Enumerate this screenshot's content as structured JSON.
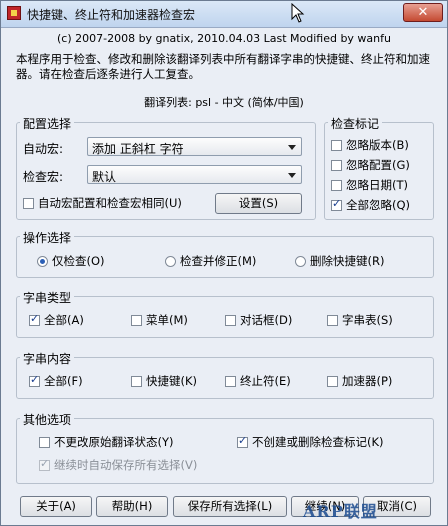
{
  "window": {
    "title": "快捷键、终止符和加速器检查宏",
    "close_label": "✕"
  },
  "header": {
    "copyright": "(c) 2007-2008 by gnatix, 2010.04.03 Last Modified by wanfu",
    "description": "本程序用于检查、修改和删除该翻译列表中所有翻译字串的快捷键、终止符和加速器。请在检查后逐条进行人工复查。",
    "translation_list": "翻译列表: psl - 中文 (简体/中国)"
  },
  "config": {
    "title": "配置选择",
    "auto_macro_label": "自动宏:",
    "auto_macro_value": "添加 正斜杠 字符",
    "check_macro_label": "检查宏:",
    "check_macro_value": "默认",
    "same_config_label": "自动宏配置和检查宏相同(U)",
    "same_config_checked": false,
    "settings_button": "设置(S)"
  },
  "check_marks": {
    "title": "检查标记",
    "items": [
      {
        "label": "忽略版本(B)",
        "checked": false
      },
      {
        "label": "忽略配置(G)",
        "checked": false
      },
      {
        "label": "忽略日期(T)",
        "checked": false
      },
      {
        "label": "全部忽略(Q)",
        "checked": true
      }
    ]
  },
  "operation": {
    "title": "操作选择",
    "options": [
      {
        "label": "仅检查(O)",
        "selected": true
      },
      {
        "label": "检查并修正(M)",
        "selected": false
      },
      {
        "label": "删除快捷键(R)",
        "selected": false
      }
    ]
  },
  "string_type": {
    "title": "字串类型",
    "items": [
      {
        "label": "全部(A)",
        "checked": true
      },
      {
        "label": "菜单(M)",
        "checked": false
      },
      {
        "label": "对话框(D)",
        "checked": false
      },
      {
        "label": "字串表(S)",
        "checked": false
      }
    ]
  },
  "string_content": {
    "title": "字串内容",
    "items": [
      {
        "label": "全部(F)",
        "checked": true
      },
      {
        "label": "快捷键(K)",
        "checked": false
      },
      {
        "label": "终止符(E)",
        "checked": false
      },
      {
        "label": "加速器(P)",
        "checked": false
      }
    ]
  },
  "other": {
    "title": "其他选项",
    "keep_state": {
      "label": "不更改原始翻译状态(Y)",
      "checked": false
    },
    "no_create": {
      "label": "不创建或删除检查标记(K)",
      "checked": true
    },
    "auto_save": {
      "label": "继续时自动保存所有选择(V)",
      "checked": true
    }
  },
  "footer": {
    "about": "关于(A)",
    "help": "帮助(H)",
    "save_all": "保存所有选择(L)",
    "continue": "继续(N)",
    "cancel": "取消(C)"
  },
  "watermark": "ARP联盟"
}
